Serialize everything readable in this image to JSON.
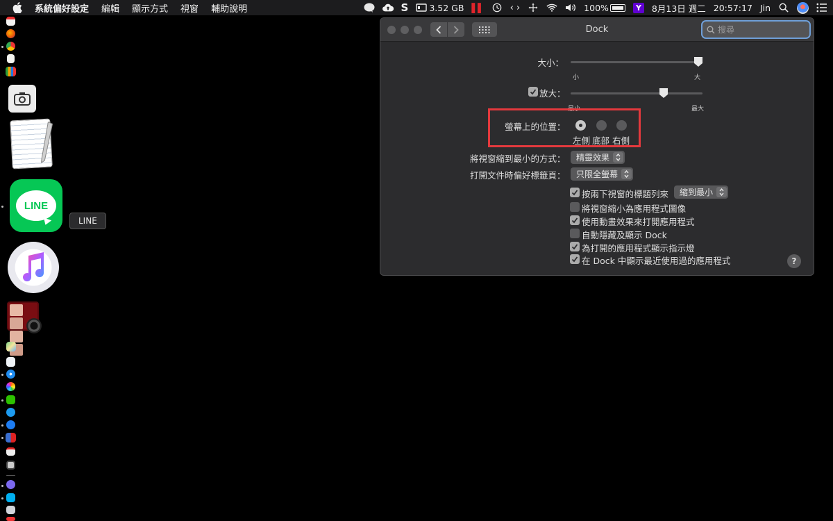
{
  "menubar": {
    "app_name": "系統偏好設定",
    "items": [
      "編輯",
      "顯示方式",
      "視窗",
      "輔助說明"
    ],
    "status": {
      "memory": "3.52 GB",
      "battery": "100%",
      "date": "8月13日 週二",
      "time": "20:57:17",
      "user": "Jin",
      "yahoo_label": "Y"
    }
  },
  "dock": {
    "tooltip": "LINE",
    "line_label": "LINE"
  },
  "window": {
    "title": "Dock",
    "search_placeholder": "搜尋",
    "size": {
      "label": "大小：",
      "min_label": "小",
      "max_label": "大",
      "value": 1.0
    },
    "magnification": {
      "label": "放大：",
      "checked": true,
      "min_label": "最小",
      "max_label": "最大",
      "value": 0.71
    },
    "position": {
      "label": "螢幕上的位置：",
      "options": [
        "左側",
        "底部",
        "右側"
      ],
      "selected": "左側"
    },
    "minimize_effect": {
      "label": "將視窗縮到最小的方式：",
      "value": "精靈效果"
    },
    "prefer_tabs": {
      "label": "打開文件時偏好標籤頁：",
      "value": "只限全螢幕"
    },
    "double_click": {
      "label": "按兩下視窗的標題列來",
      "checked": true,
      "value": "縮到最小"
    },
    "options": [
      {
        "label": "將視窗縮小為應用程式圖像",
        "checked": false
      },
      {
        "label": "使用動畫效果來打開應用程式",
        "checked": true
      },
      {
        "label": "自動隱藏及顯示 Dock",
        "checked": false
      },
      {
        "label": "為打開的應用程式顯示指示燈",
        "checked": true
      },
      {
        "label": "在 Dock 中顯示最近使用過的應用程式",
        "checked": true
      }
    ],
    "help_label": "?"
  },
  "colors": {
    "highlight": "#e4393d",
    "line_green": "#06c755",
    "window_bg": "#2c2c2e"
  }
}
